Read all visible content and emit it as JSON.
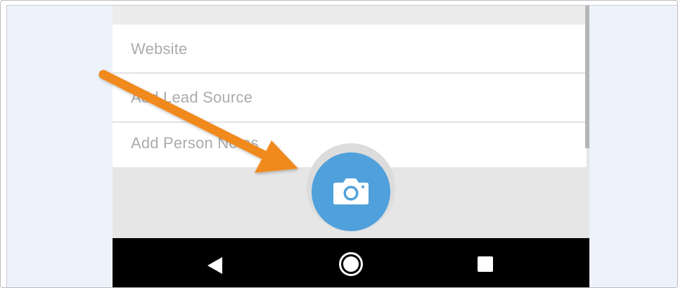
{
  "form": {
    "fields": [
      {
        "label": "Website"
      },
      {
        "label": "Add Lead Source"
      },
      {
        "label": "Add Person Notes"
      }
    ]
  },
  "fab": {
    "icon": "camera-icon",
    "color": "#4fa0db"
  },
  "navbar": {
    "back_icon": "back-triangle-icon",
    "home_icon": "home-circle-icon",
    "recent_icon": "recent-apps-square-icon"
  },
  "annotation": {
    "icon": "arrow-icon",
    "color": "#f08a1d"
  }
}
